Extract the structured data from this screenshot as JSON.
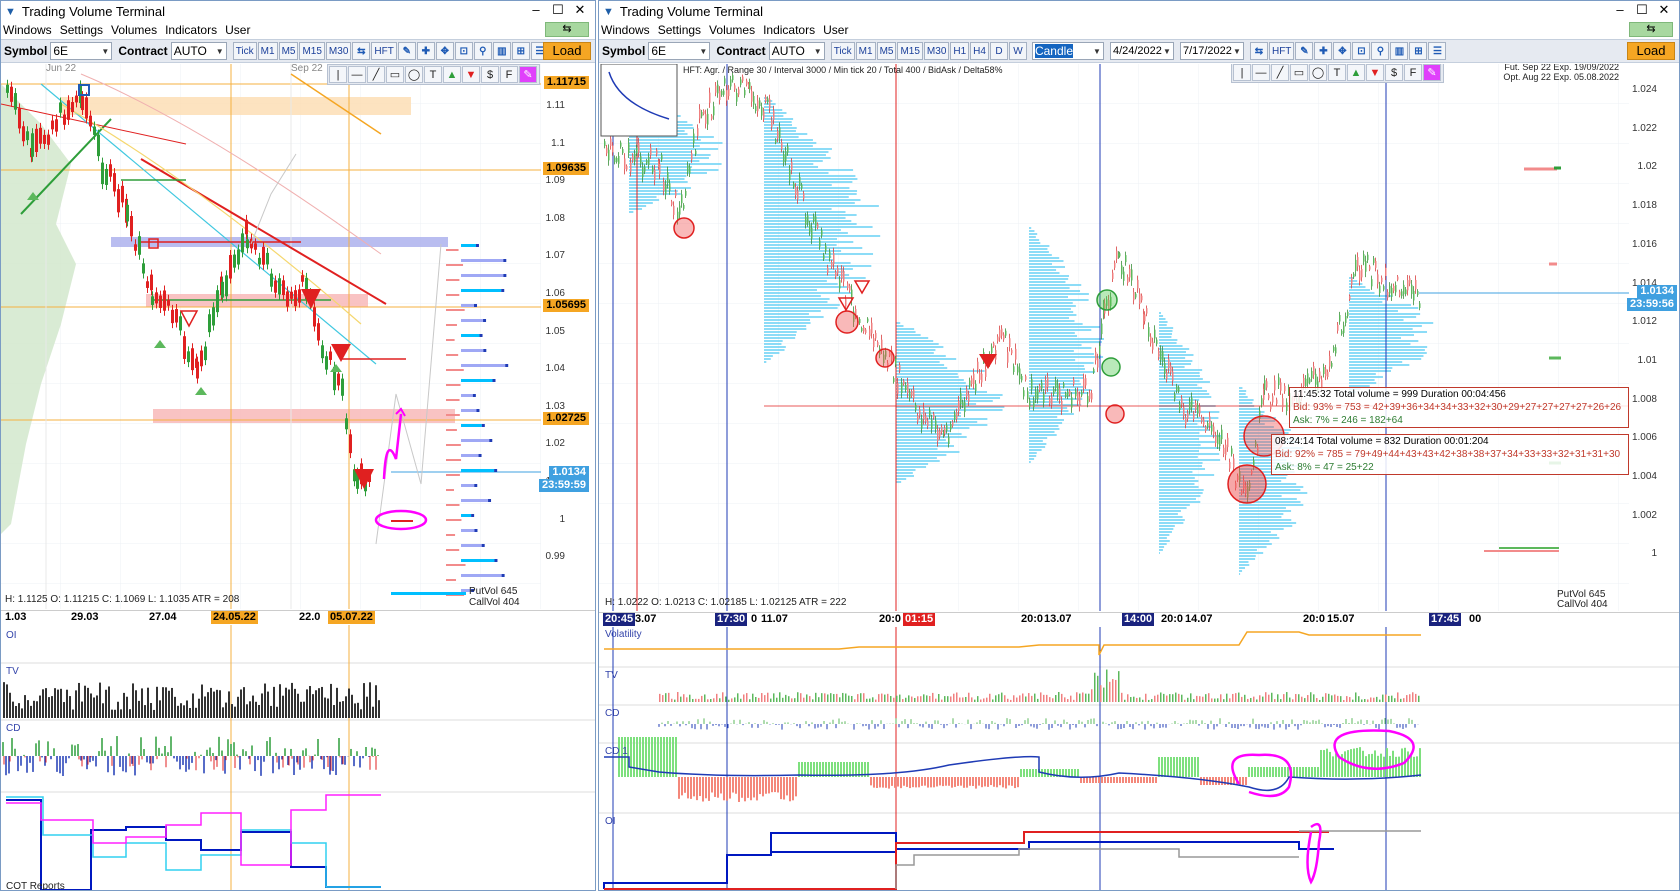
{
  "left": {
    "title": "Trading Volume Terminal",
    "menu": [
      "Windows",
      "Settings",
      "Volumes",
      "Indicators",
      "User"
    ],
    "toolbar": {
      "symbol_label": "Symbol",
      "symbol_value": "6E",
      "contract_label": "Contract",
      "contract_value": "AUTO",
      "timeframes": [
        "Tick",
        "M1",
        "M5",
        "M15",
        "M30"
      ],
      "hft": "HFT",
      "load": "Load"
    },
    "price_axis": [
      "1.11",
      "1.1",
      "1.09",
      "1.08",
      "1.07",
      "1.06",
      "1.05",
      "1.04",
      "1.03",
      "1.02",
      "1.01",
      "1",
      "0.99"
    ],
    "price_tags": {
      "p1": "1.11715",
      "p2": "1.09635",
      "p3": "1.05695",
      "p4": "1.02725",
      "last": "1.0134",
      "timer": "23:59:59"
    },
    "month_labels": {
      "jun": "Jun 22",
      "sep": "Sep 22"
    },
    "ohlc": "H: 1.1125   O: 1.11215   C: 1.1069   L: 1.1035   ATR = 208",
    "putvol": "PutVol  645",
    "callvol": "CallVol  404",
    "timebar": [
      "1.03",
      "29.03",
      "27.04",
      "24.05.22",
      "22.0",
      "05.07.22"
    ],
    "panes": [
      "OI",
      "TV",
      "CD",
      "COT Reports"
    ]
  },
  "right": {
    "title": "Trading Volume Terminal",
    "menu": [
      "Windows",
      "Settings",
      "Volumes",
      "Indicators",
      "User"
    ],
    "toolbar": {
      "symbol_label": "Symbol",
      "symbol_value": "6E",
      "contract_label": "Contract",
      "contract_value": "AUTO",
      "timeframes": [
        "Tick",
        "M1",
        "M5",
        "M15",
        "M30",
        "H1",
        "H4",
        "D",
        "W"
      ],
      "chart_type": "Candle",
      "date_from": "4/24/2022",
      "date_to": "7/17/2022",
      "hft": "HFT",
      "load": "Load"
    },
    "header_info": "HFT: Agr. / Range 30 / Interval 3000 / Min tick 20 / Total 400 / BidAsk / Delta58%",
    "expiry1": "Fut. Sep 22 Exp. 19/09/2022",
    "expiry2": "Opt. Aug 22 Exp. 05.08.2022",
    "price_axis": [
      "1.024",
      "1.022",
      "1.02",
      "1.018",
      "1.016",
      "1.014",
      "1.012",
      "1.01",
      "1.008",
      "1.006",
      "1.004",
      "1.002",
      "1"
    ],
    "price_tags": {
      "last": "1.0134",
      "timer": "23:59:56"
    },
    "tooltip1": {
      "head": "11:45:32   Total volume = 999   Duration 00:04:456",
      "bid": "Bid:  93%  =  753  =  42+39+36+34+34+33+32+30+29+27+27+27+27+26+26",
      "ask": "Ask:  7%  =  246  =  182+64"
    },
    "tooltip2": {
      "head": "08:24:14   Total volume = 832   Duration 00:01:204",
      "bid": "Bid:  92%  =  785  =  79+49+44+43+43+42+38+38+37+34+33+33+32+31+31+30",
      "ask": "Ask:  8%  =  47  =  25+22"
    },
    "ohlc": "H: 1.0222   O: 1.0213   C: 1.02185   L: 1.02125   ATR = 222",
    "putvol": "PutVol  645",
    "callvol": "CallVol  404",
    "timebar": [
      "20:45",
      "3.07",
      "17:30",
      "0",
      "11.07",
      "20:0",
      "01:15",
      "20:0",
      "13.07",
      "14:00",
      "20:0",
      "14.07",
      "20:0",
      "15.07",
      "17:45",
      "00"
    ],
    "panes": [
      "Volatility",
      "TV",
      "CD",
      "CD 1",
      "OI"
    ]
  },
  "colors": {
    "accent": "#1e5ea8",
    "load": "#f5a623",
    "bull": "#2e9e3a",
    "bear": "#e02020",
    "profile": "#00bfff",
    "cursor": "#3fa0e0"
  }
}
